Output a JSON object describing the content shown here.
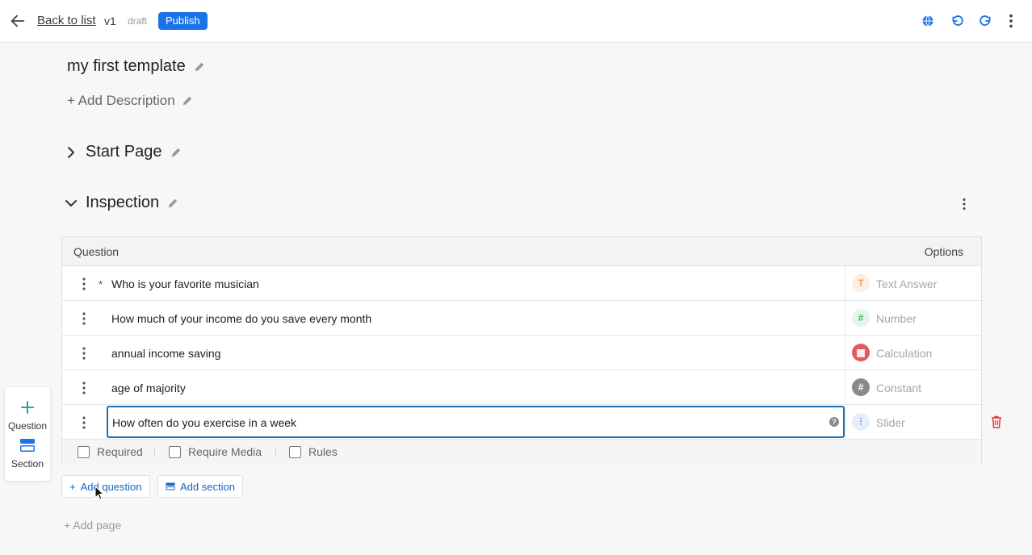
{
  "header": {
    "back_label": "Back to list",
    "version": "v1",
    "status": "draft",
    "publish_label": "Publish"
  },
  "template": {
    "title": "my first template",
    "add_description": "+ Add Description"
  },
  "pages": {
    "start_page": "Start Page",
    "inspection": "Inspection"
  },
  "table": {
    "col_question": "Question",
    "col_options": "Options",
    "rows": [
      {
        "text": "Who is your favorite musician",
        "required": "*",
        "type": "Text Answer",
        "type_glyph": "T",
        "type_color": "#f6a15b"
      },
      {
        "text": "How much of your income do you save every month",
        "required": "",
        "type": "Number",
        "type_glyph": "#",
        "type_color": "#43b86a"
      },
      {
        "text": "annual income saving",
        "required": "",
        "type": "Calculation",
        "type_glyph": "▦",
        "type_color": "#e15b5b"
      },
      {
        "text": "age of majority",
        "required": "",
        "type": "Constant",
        "type_glyph": "#",
        "type_color": "#8a8a8a"
      },
      {
        "text": "How often do you exercise in a week",
        "required": "",
        "type": "Slider",
        "type_glyph": "⫶",
        "type_color": "#5b8fd6"
      }
    ],
    "help_glyph": "?"
  },
  "row_options": {
    "required": "Required",
    "require_media": "Require Media",
    "rules": "Rules"
  },
  "float_panel": {
    "question": "Question",
    "section": "Section"
  },
  "actions": {
    "add_question": "Add question",
    "add_section": "Add section",
    "add_page": "+ Add page",
    "plus": "+"
  },
  "colors": {
    "accent": "#1a73e8",
    "link": "#1565c0",
    "teal": "#26a69a",
    "danger": "#e53935",
    "active_border": "#1f6fb2"
  }
}
